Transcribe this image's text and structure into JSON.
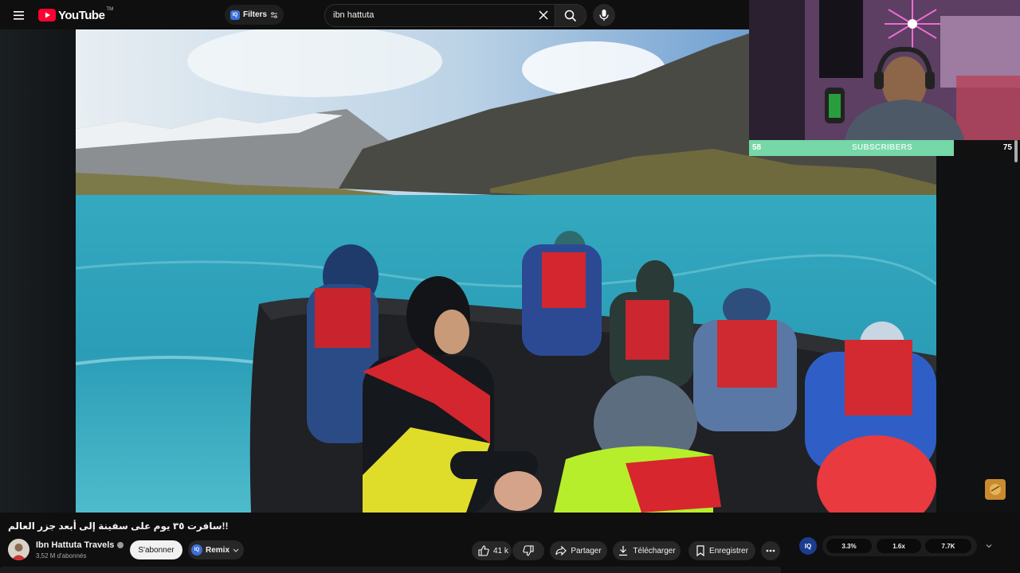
{
  "header": {
    "logo_text": "YouTube",
    "logo_tm": "TM",
    "filters_label": "Filters",
    "filters_badge": "IQ",
    "search_value": "ibn hattuta"
  },
  "overlay": {
    "subscriber_goal": {
      "current": "58",
      "label": "SUBSCRIBERS",
      "target": "75",
      "progress": 0.77,
      "fill_color": "#76d7a8"
    }
  },
  "video": {
    "title": "!!سافرت ٣٥ يوم على سفينة إلى أبعد جزر العالم"
  },
  "channel": {
    "name": "Ibn Hattuta Travels",
    "subscribers": "3,52 M d'abonnés"
  },
  "actions": {
    "subscribe_label": "S'abonner",
    "remix_badge": "IQ",
    "remix_label": "Remix",
    "like_count": "41 k",
    "share_label": "Partager",
    "download_label": "Télécharger",
    "save_label": "Enregistrer"
  },
  "stats": {
    "badge": "IQ",
    "values": [
      "3.3%",
      "1.6x",
      "7.7K"
    ]
  },
  "colors": {
    "youtube_red": "#ff0033",
    "background": "#0f0f0f",
    "accent_blue": "#3e6fd8"
  }
}
